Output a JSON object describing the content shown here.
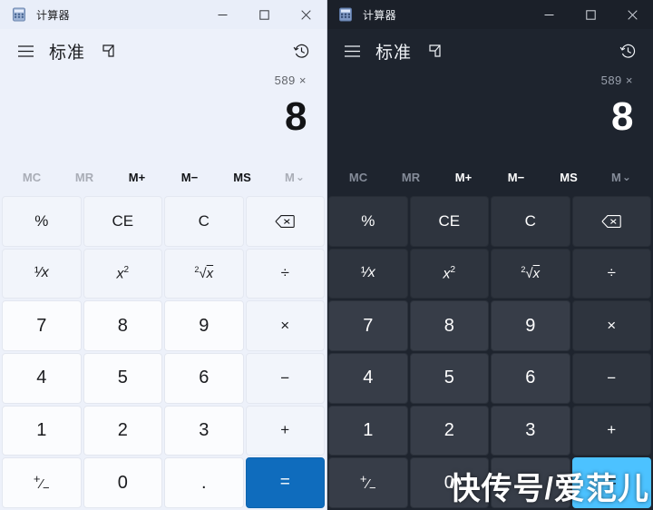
{
  "window": {
    "title": "计算器",
    "app_icon": "calculator-icon",
    "minimize_label": "—",
    "maximize_label": "□",
    "close_label": "✕"
  },
  "nav": {
    "menu_icon": "hamburger-menu-icon",
    "mode_title": "标准",
    "keep_on_top_icon": "keep-on-top-icon",
    "history_icon": "history-clock-icon"
  },
  "display": {
    "expression": "589 ×",
    "result": "8"
  },
  "memory": {
    "buttons": [
      {
        "label": "MC",
        "name": "memory-clear",
        "disabled": true
      },
      {
        "label": "MR",
        "name": "memory-recall",
        "disabled": true
      },
      {
        "label": "M+",
        "name": "memory-add",
        "disabled": false
      },
      {
        "label": "M−",
        "name": "memory-subtract",
        "disabled": false
      },
      {
        "label": "MS",
        "name": "memory-store",
        "disabled": false
      },
      {
        "label": "M",
        "name": "memory-dropdown",
        "disabled": true,
        "chevron": "⌄"
      }
    ]
  },
  "keypad": {
    "rows": [
      [
        {
          "label": "%",
          "name": "percent-button",
          "kind": "fn"
        },
        {
          "label": "CE",
          "name": "clear-entry-button",
          "kind": "fn"
        },
        {
          "label": "C",
          "name": "clear-button",
          "kind": "fn"
        },
        {
          "label": "",
          "name": "backspace-button",
          "kind": "fn",
          "icon": "backspace-icon"
        }
      ],
      [
        {
          "label": "1/x",
          "name": "reciprocal-button",
          "kind": "fn",
          "glyph": "reciprocal"
        },
        {
          "label": "x²",
          "name": "square-button",
          "kind": "fn",
          "glyph": "square"
        },
        {
          "label": "²√x",
          "name": "square-root-button",
          "kind": "fn",
          "glyph": "sqrt"
        },
        {
          "label": "÷",
          "name": "divide-button",
          "kind": "op"
        }
      ],
      [
        {
          "label": "7",
          "name": "digit-7-button",
          "kind": "num"
        },
        {
          "label": "8",
          "name": "digit-8-button",
          "kind": "num"
        },
        {
          "label": "9",
          "name": "digit-9-button",
          "kind": "num"
        },
        {
          "label": "×",
          "name": "multiply-button",
          "kind": "op"
        }
      ],
      [
        {
          "label": "4",
          "name": "digit-4-button",
          "kind": "num"
        },
        {
          "label": "5",
          "name": "digit-5-button",
          "kind": "num"
        },
        {
          "label": "6",
          "name": "digit-6-button",
          "kind": "num"
        },
        {
          "label": "−",
          "name": "subtract-button",
          "kind": "op"
        }
      ],
      [
        {
          "label": "1",
          "name": "digit-1-button",
          "kind": "num"
        },
        {
          "label": "2",
          "name": "digit-2-button",
          "kind": "num"
        },
        {
          "label": "3",
          "name": "digit-3-button",
          "kind": "num"
        },
        {
          "label": "+",
          "name": "add-button",
          "kind": "op"
        }
      ],
      [
        {
          "label": "+/−",
          "name": "sign-toggle-button",
          "kind": "num",
          "glyph": "plusminus"
        },
        {
          "label": "0",
          "name": "digit-0-button",
          "kind": "num"
        },
        {
          "label": ".",
          "name": "decimal-point-button",
          "kind": "num"
        },
        {
          "label": "=",
          "name": "equals-button",
          "kind": "eq"
        }
      ]
    ]
  },
  "themes": {
    "light": {
      "name": "light",
      "background": "#edf1fa",
      "accent": "#0f6cbd"
    },
    "dark": {
      "name": "dark",
      "background": "#1e242e",
      "accent": "#4cc2ff"
    }
  },
  "watermark": {
    "text": "快传号/爱范儿"
  }
}
